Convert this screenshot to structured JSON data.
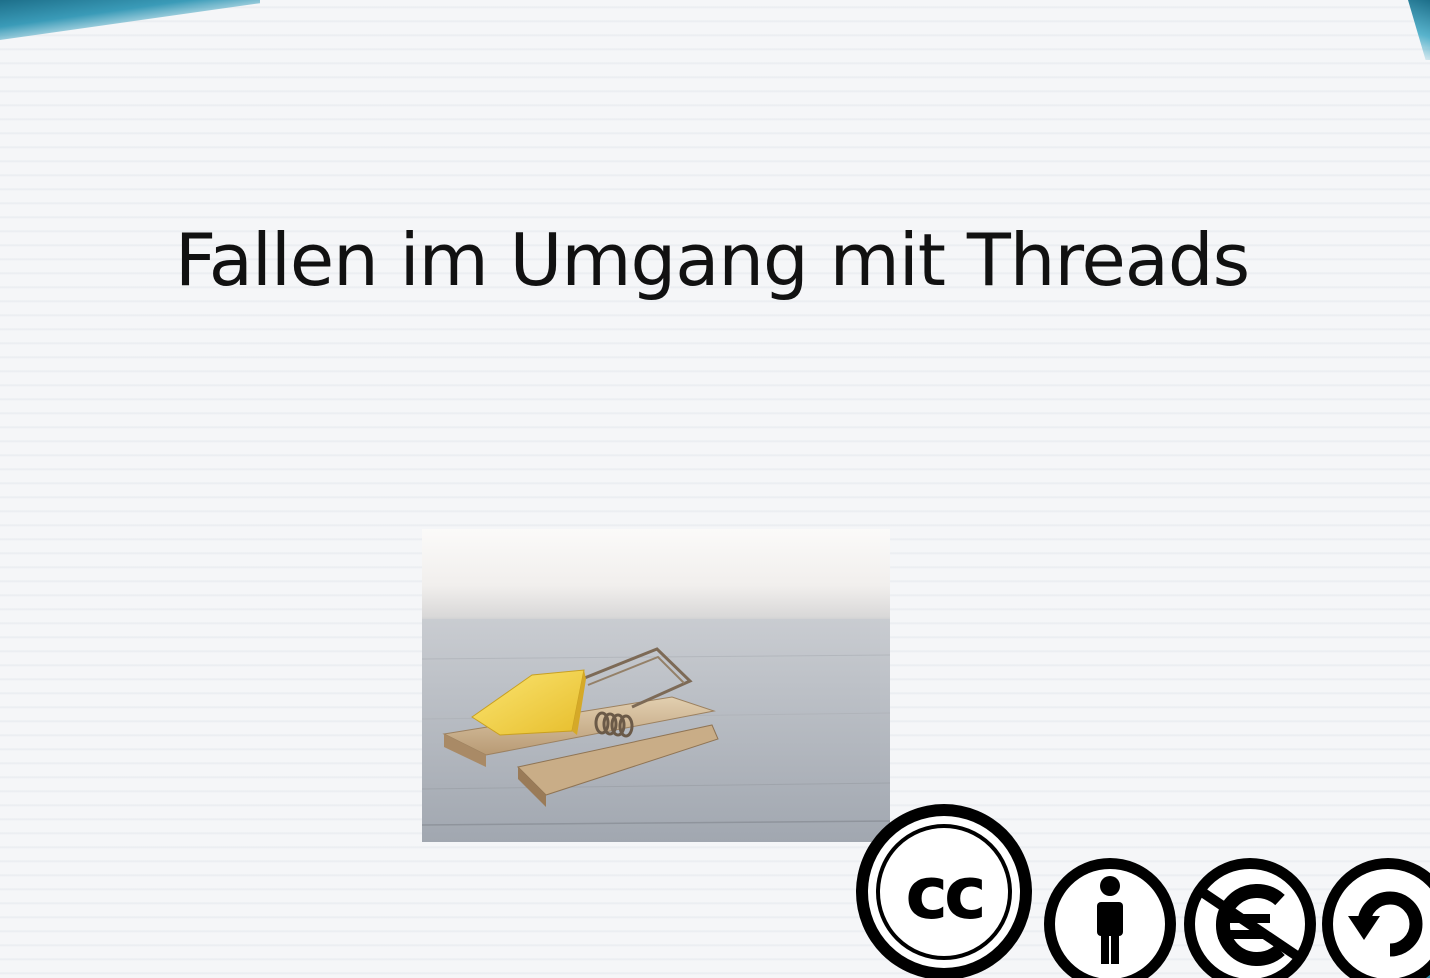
{
  "slide": {
    "title": "Fallen im Umgang mit Threads",
    "image": {
      "alt": "mousetrap-with-cheese"
    }
  },
  "license": {
    "badges": [
      {
        "icon": "cc-icon",
        "text": "cc"
      },
      {
        "icon": "by-attribution-icon"
      },
      {
        "icon": "non-commercial-euro-icon"
      },
      {
        "icon": "share-alike-icon"
      }
    ]
  },
  "colors": {
    "accent": "#2b8aa6",
    "title": "#111111",
    "badge": "#000000"
  }
}
